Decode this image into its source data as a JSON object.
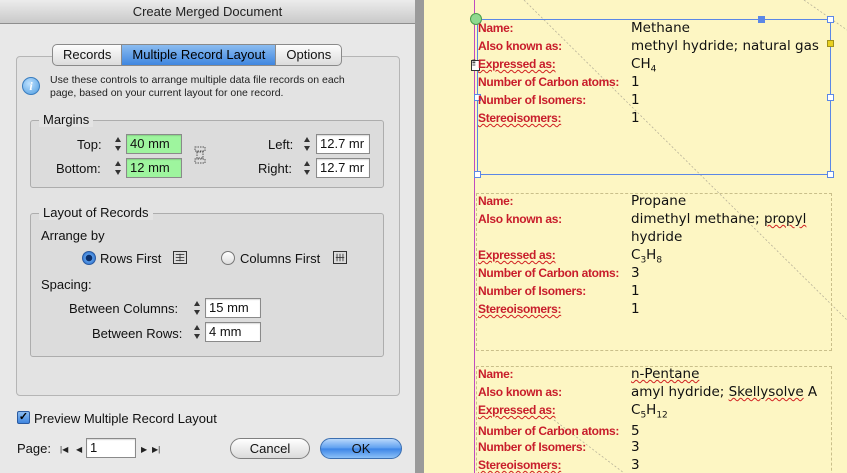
{
  "dialog": {
    "title": "Create Merged Document",
    "tabs": [
      "Records",
      "Multiple Record Layout",
      "Options"
    ],
    "active_tab": "Multiple Record Layout",
    "info_text": "Use these controls to arrange multiple data file records on each page, based on your current layout for one record.",
    "margins": {
      "group_title": "Margins",
      "top_label": "Top:",
      "top_value": "40 mm",
      "bottom_label": "Bottom:",
      "bottom_value": "12 mm",
      "left_label": "Left:",
      "left_value": "12.7 mr",
      "right_label": "Right:",
      "right_value": "12.7 mr"
    },
    "layout": {
      "group_title": "Layout of Records",
      "arrange_by_label": "Arrange by",
      "rows_first_label": "Rows First",
      "columns_first_label": "Columns First",
      "selected_option": "Rows First",
      "spacing_label": "Spacing:",
      "between_columns_label": "Between Columns:",
      "between_columns_value": "15 mm",
      "between_rows_label": "Between Rows:",
      "between_rows_value": "4 mm"
    },
    "preview_label": "Preview Multiple Record Layout",
    "preview_checked": true,
    "page_label": "Page:",
    "page_value": "1",
    "cancel_label": "Cancel",
    "ok_label": "OK"
  },
  "records": [
    {
      "fields": [
        {
          "name": "Name:",
          "value": "Methane"
        },
        {
          "name": "Also known as:",
          "value": "methyl hydride; natural gas"
        },
        {
          "name": "Expressed as:",
          "value": "CH",
          "formula": [
            [
              "C",
              ""
            ],
            [
              "H",
              "4"
            ]
          ]
        },
        {
          "name": "Number of Carbon atoms:",
          "value": "1"
        },
        {
          "name": "Number of Isomers:",
          "value": "1"
        },
        {
          "name": "Stereoisomers:",
          "value": "1"
        }
      ]
    },
    {
      "fields": [
        {
          "name": "Name:",
          "value": "Propane"
        },
        {
          "name": "Also known as:",
          "value": "dimethyl methane; propyl hydride"
        },
        {
          "name": "Expressed as:",
          "value": "C3H8",
          "formula": [
            [
              "C",
              "3"
            ],
            [
              "H",
              "8"
            ]
          ]
        },
        {
          "name": "Number of Carbon atoms:",
          "value": "3"
        },
        {
          "name": "Number of Isomers:",
          "value": "1"
        },
        {
          "name": "Stereoisomers:",
          "value": "1"
        }
      ]
    },
    {
      "fields": [
        {
          "name": "Name:",
          "value": "n-Pentane"
        },
        {
          "name": "Also known as:",
          "value": "amyl hydride; Skellysolve A"
        },
        {
          "name": "Expressed as:",
          "value": "C5H12",
          "formula": [
            [
              "C",
              "5"
            ],
            [
              "H",
              "12"
            ]
          ]
        },
        {
          "name": "Number of Carbon atoms:",
          "value": "5"
        },
        {
          "name": "Number of Isomers:",
          "value": "3"
        },
        {
          "name": "Stereoisomers:",
          "value": "3"
        }
      ]
    }
  ],
  "colors": {
    "field_name": "#c81d2b",
    "page_background": "#fdf6c3",
    "selection": "#5b87e6",
    "margin_guide": "#c04ac0",
    "highlighted_field": "#9ef59e"
  }
}
